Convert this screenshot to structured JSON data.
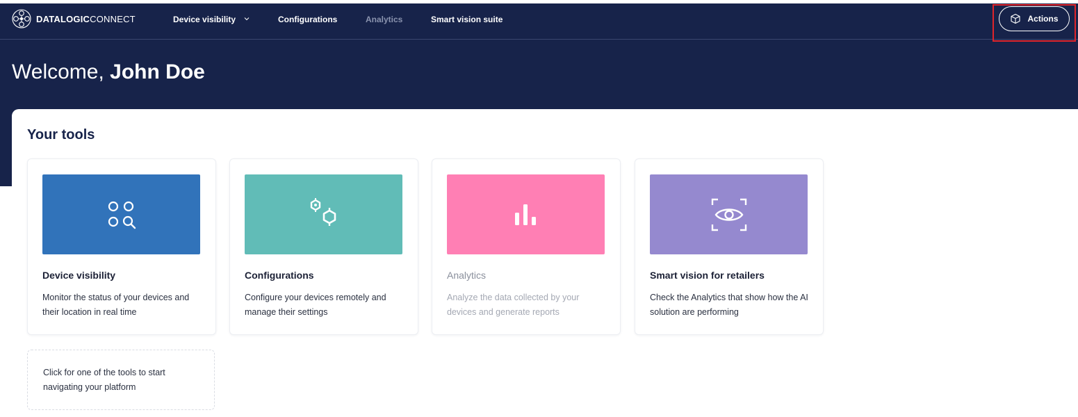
{
  "brand": {
    "name_bold": "DATALOGIC",
    "name_light": "CONNECT"
  },
  "nav": {
    "items": [
      {
        "label": "Device visibility",
        "has_dropdown": true,
        "disabled": false
      },
      {
        "label": "Configurations",
        "has_dropdown": false,
        "disabled": false
      },
      {
        "label": "Analytics",
        "has_dropdown": false,
        "disabled": true
      },
      {
        "label": "Smart vision suite",
        "has_dropdown": false,
        "disabled": false
      }
    ],
    "actions_label": "Actions"
  },
  "hero": {
    "greeting": "Welcome, ",
    "user_name": "John Doe"
  },
  "tools": {
    "title": "Your tools",
    "cards": [
      {
        "title": "Device visibility",
        "description": "Monitor the status of your devices and their location in real time",
        "color": "#3173ba",
        "icon": "device-grid-search-icon",
        "disabled": false
      },
      {
        "title": "Configurations",
        "description": "Configure your devices remotely and manage their settings",
        "color": "#61bcb7",
        "icon": "gears-icon",
        "disabled": false
      },
      {
        "title": "Analytics",
        "description": "Analyze the data collected by your devices and generate reports",
        "color": "#ff7fb4",
        "icon": "bar-chart-icon",
        "disabled": true
      },
      {
        "title": "Smart vision for retailers",
        "description": "Check the Analytics that show how the AI solution are performing",
        "color": "#9589cf",
        "icon": "eye-scan-icon",
        "disabled": false
      }
    ],
    "hint": "Click for one of the tools to start navigating your platform"
  },
  "colors": {
    "navy": "#17234a",
    "highlight": "#e0242a"
  }
}
